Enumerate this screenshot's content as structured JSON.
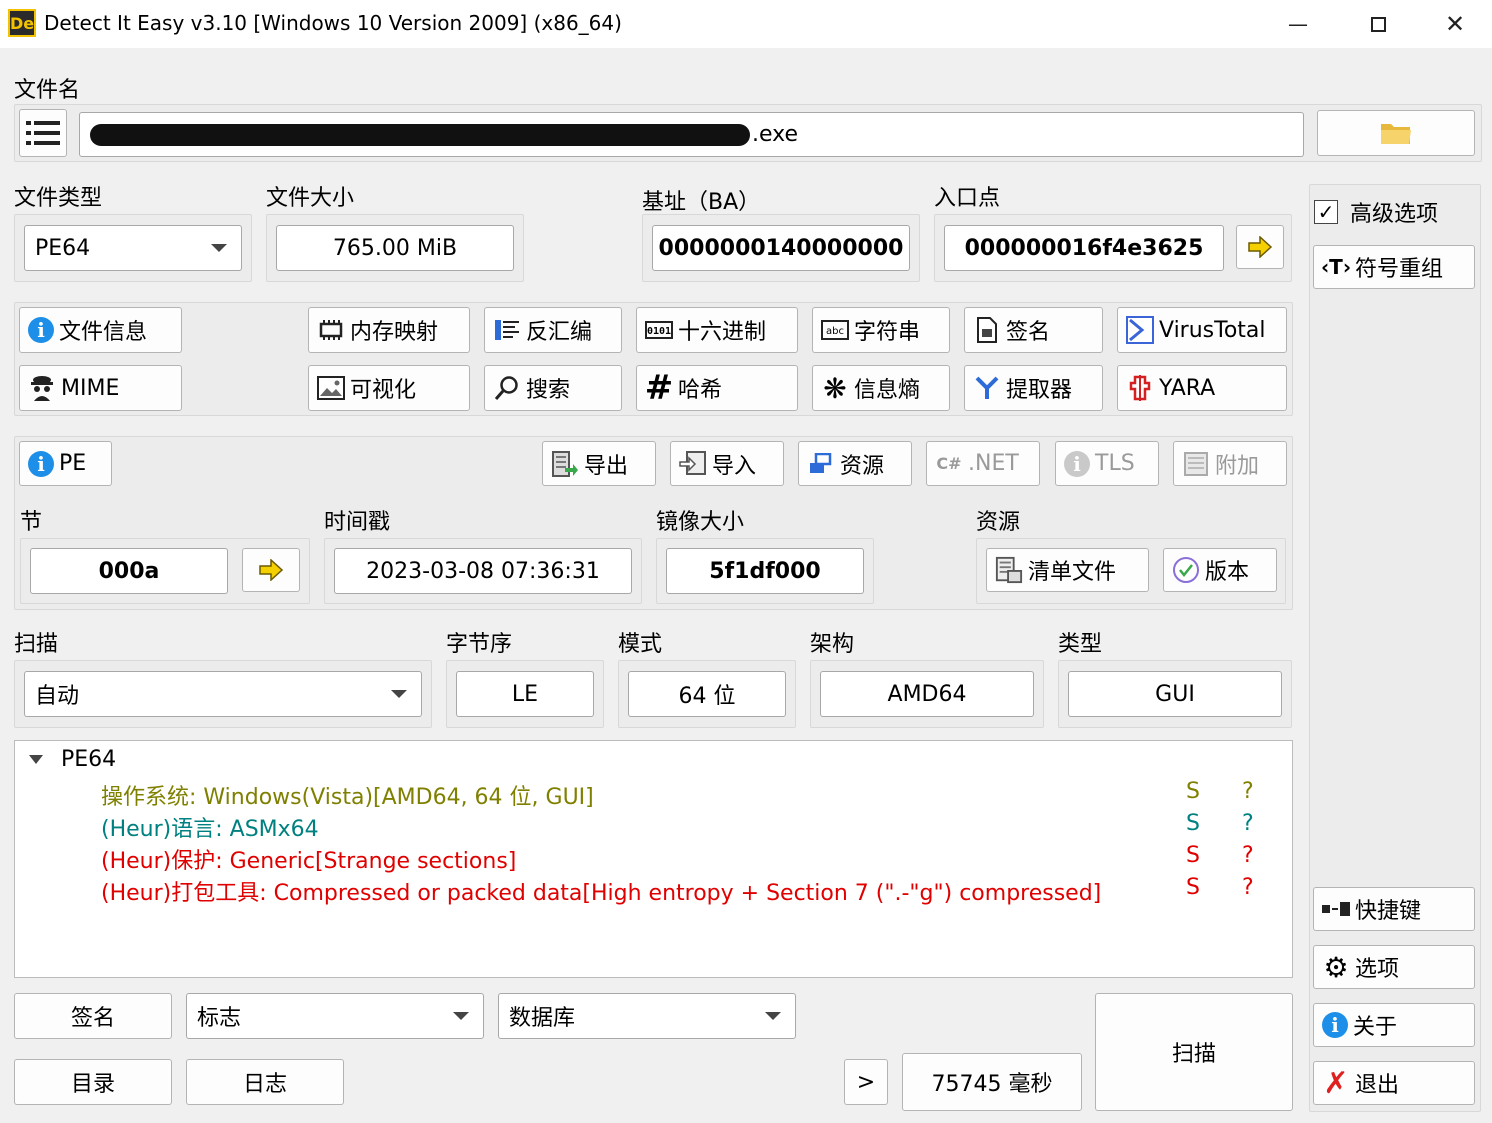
{
  "window": {
    "title": "Detect It Easy v3.10 [Windows 10 Version 2009] (x86_64)",
    "app_icon_text": "De"
  },
  "file": {
    "label": "文件名",
    "name_suffix": ".exe"
  },
  "info": {
    "file_type_label": "文件类型",
    "file_type_value": "PE64",
    "file_size_label": "文件大小",
    "file_size_value": "765.00 MiB",
    "base_label": "基址（BA）",
    "base_value": "0000000140000000",
    "entry_label": "入口点",
    "entry_value": "000000016f4e3625"
  },
  "tools": {
    "file_info": "文件信息",
    "memory_map": "内存映射",
    "disasm": "反汇编",
    "hex": "十六进制",
    "strings": "字符串",
    "signature": "签名",
    "virustotal": "VirusTotal",
    "mime": "MIME",
    "visualize": "可视化",
    "search": "搜索",
    "hash": "哈希",
    "entropy": "信息熵",
    "extractor": "提取器",
    "yara": "YARA"
  },
  "pe": {
    "pe_button": "PE",
    "export": "导出",
    "import": "导入",
    "resources": "资源",
    "dotnet": ".NET",
    "tls": "TLS",
    "overlay": "附加",
    "sections_label": "节",
    "sections_value": "000a",
    "timestamp_label": "时间戳",
    "timestamp_value": "2023-03-08 07:36:31",
    "image_size_label": "镜像大小",
    "image_size_value": "5f1df000",
    "resources_label": "资源",
    "manifest": "清单文件",
    "version": "版本"
  },
  "scan": {
    "scan_label": "扫描",
    "scan_mode": "自动",
    "endian_label": "字节序",
    "endian_value": "LE",
    "mode_label": "模式",
    "mode_value": "64 位",
    "arch_label": "架构",
    "arch_value": "AMD64",
    "type_label": "类型",
    "type_value": "GUI"
  },
  "results": {
    "root": "PE64",
    "items": [
      {
        "text": "操作系统: Windows(Vista)[AMD64, 64 位, GUI]",
        "s": "S",
        "q": "?"
      },
      {
        "text": "(Heur)语言: ASMx64",
        "s": "S",
        "q": "?"
      },
      {
        "text": "(Heur)保护: Generic[Strange sections]",
        "s": "S",
        "q": "?"
      },
      {
        "text": "(Heur)打包工具: Compressed or packed data[High entropy + Section 7 (\".-\"g\") compressed]",
        "s": "S",
        "q": "?"
      }
    ]
  },
  "bottom": {
    "signatures": "签名",
    "flags": "标志",
    "database": "数据库",
    "directory": "目录",
    "log": "日志",
    "more": ">",
    "elapsed": "75745 毫秒",
    "scan": "扫描"
  },
  "side": {
    "advanced": "高级选项",
    "demangle": "符号重组",
    "shortcuts": "快捷键",
    "options": "选项",
    "about": "关于",
    "exit": "退出"
  },
  "colors": {
    "olive": "#808000",
    "teal": "#008080",
    "red": "#e00000",
    "info_blue": "#1e8fe8"
  }
}
